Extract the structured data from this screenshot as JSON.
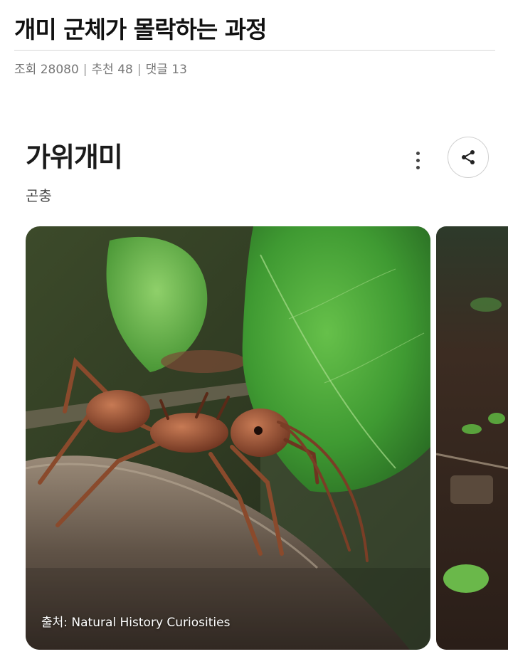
{
  "post": {
    "title": "개미 군체가 몰락하는 과정",
    "meta": {
      "views_label": "조회",
      "views": "28080",
      "recommend_label": "추천",
      "recommend": "48",
      "comments_label": "댓글",
      "comments": "13",
      "separator": "|"
    }
  },
  "card": {
    "title": "가위개미",
    "subtitle": "곤충",
    "more_icon": "more-vertical-icon",
    "share_icon": "share-icon",
    "image_credit": "출처: Natural History Curiosities"
  },
  "colors": {
    "title_text": "#111111",
    "meta_text": "#777777",
    "divider": "#d6d6d6",
    "leaf_green": "#3f9a32",
    "ant_brown": "#8a4a2c"
  }
}
